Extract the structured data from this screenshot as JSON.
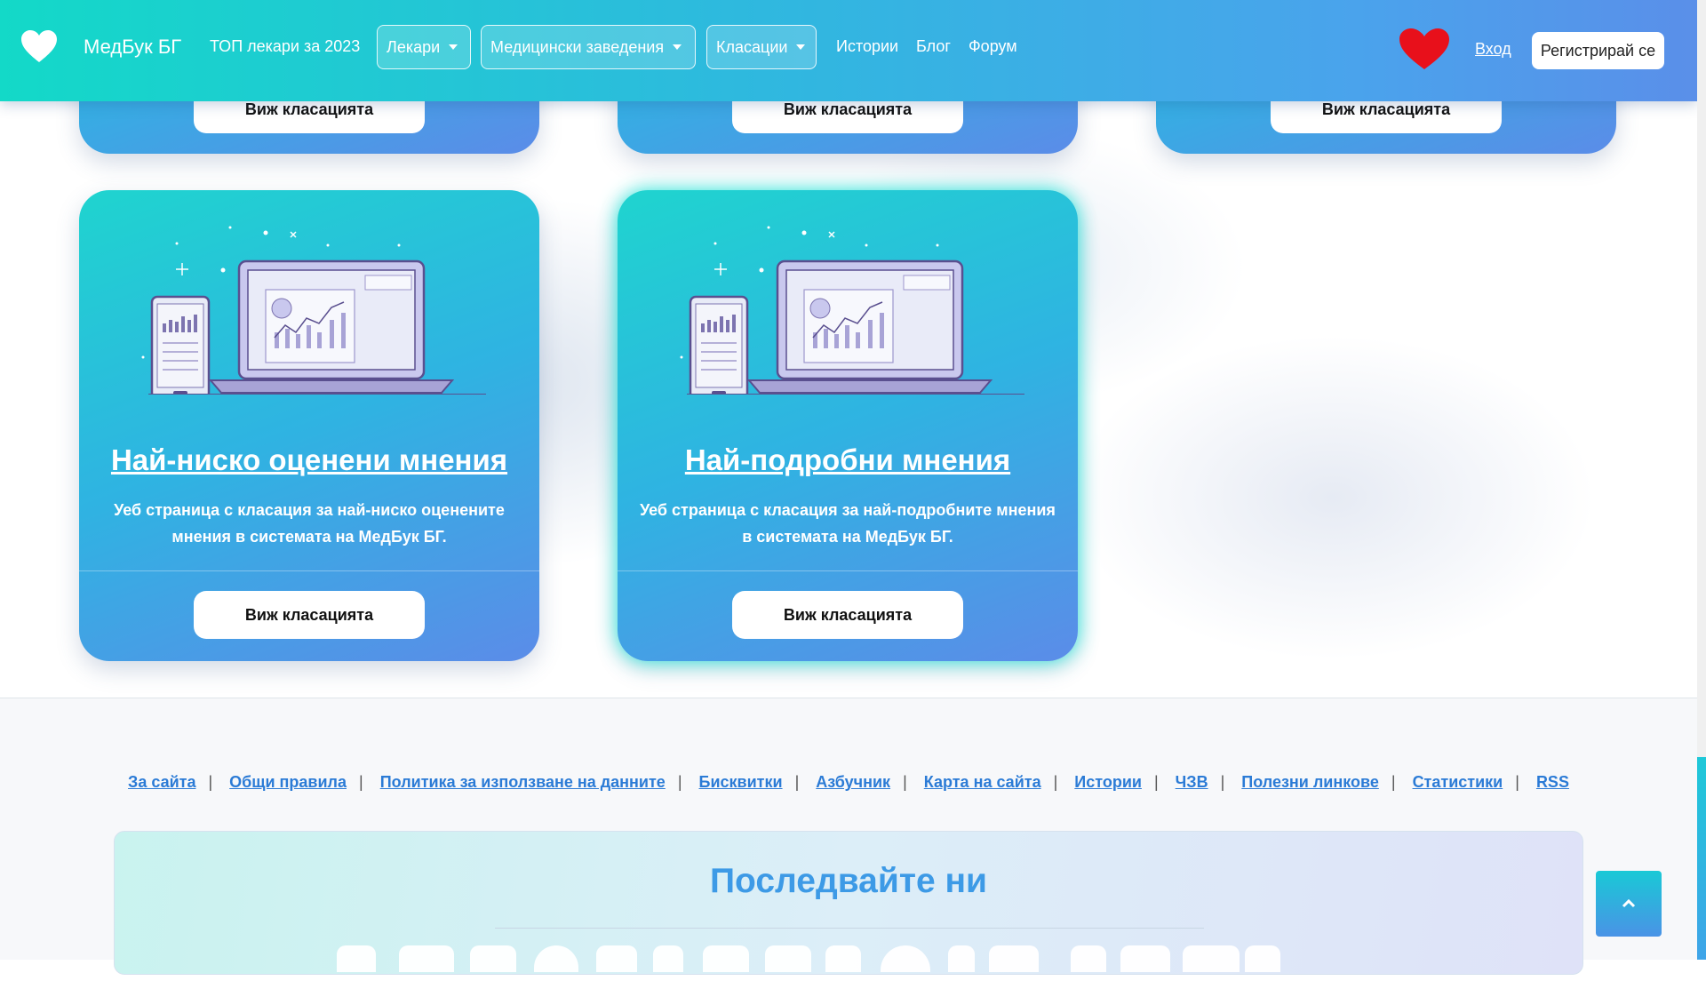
{
  "header": {
    "brand": "МедБук БГ",
    "top_link": "ТОП лекари за 2023",
    "dropdowns": [
      "Лекари",
      "Медицински заведения",
      "Класации"
    ],
    "links": [
      "Истории",
      "Блог",
      "Форум"
    ],
    "login": "Вход",
    "register": "Регистрирай се",
    "colors": {
      "gradient_start": "#13d9c8",
      "gradient_end": "#5a8fe9",
      "heart": "#e8101b"
    }
  },
  "cards_top_row": [
    {
      "button": "Виж класацията"
    },
    {
      "button": "Виж класацията"
    },
    {
      "button": "Виж класацията"
    }
  ],
  "cards": [
    {
      "title": "Най-ниско оценени мнения",
      "description": "Уеб страница с класация за най-ниско оценените мнения в системата на МедБук БГ.",
      "button": "Виж класацията"
    },
    {
      "title": "Най-подробни мнения",
      "description": "Уеб страница с класация за най-подробните мнения в системата на МедБук БГ.",
      "button": "Виж класацията"
    }
  ],
  "footer": {
    "links": [
      "За сайта",
      "Общи правила",
      "Политика за използване на данните",
      "Бисквитки",
      "Азбучник",
      "Карта на сайта",
      "Истории",
      "ЧЗВ",
      "Полезни линкове",
      "Статистики",
      "RSS"
    ],
    "follow_title": "Последвайте ни",
    "social_icons": [
      "facebook-icon",
      "youtube-icon",
      "instagram-icon",
      "pinterest-icon",
      "linkedin-icon",
      "twitter-icon",
      "viber-icon",
      "skype-icon",
      "rss-icon",
      "whatsapp-icon",
      "tumblr-icon",
      "flickr-icon",
      "reddit-icon",
      "google-icon",
      "vk-icon",
      "delicious-icon"
    ]
  },
  "scroll_top_icon": "chevron-up-icon"
}
